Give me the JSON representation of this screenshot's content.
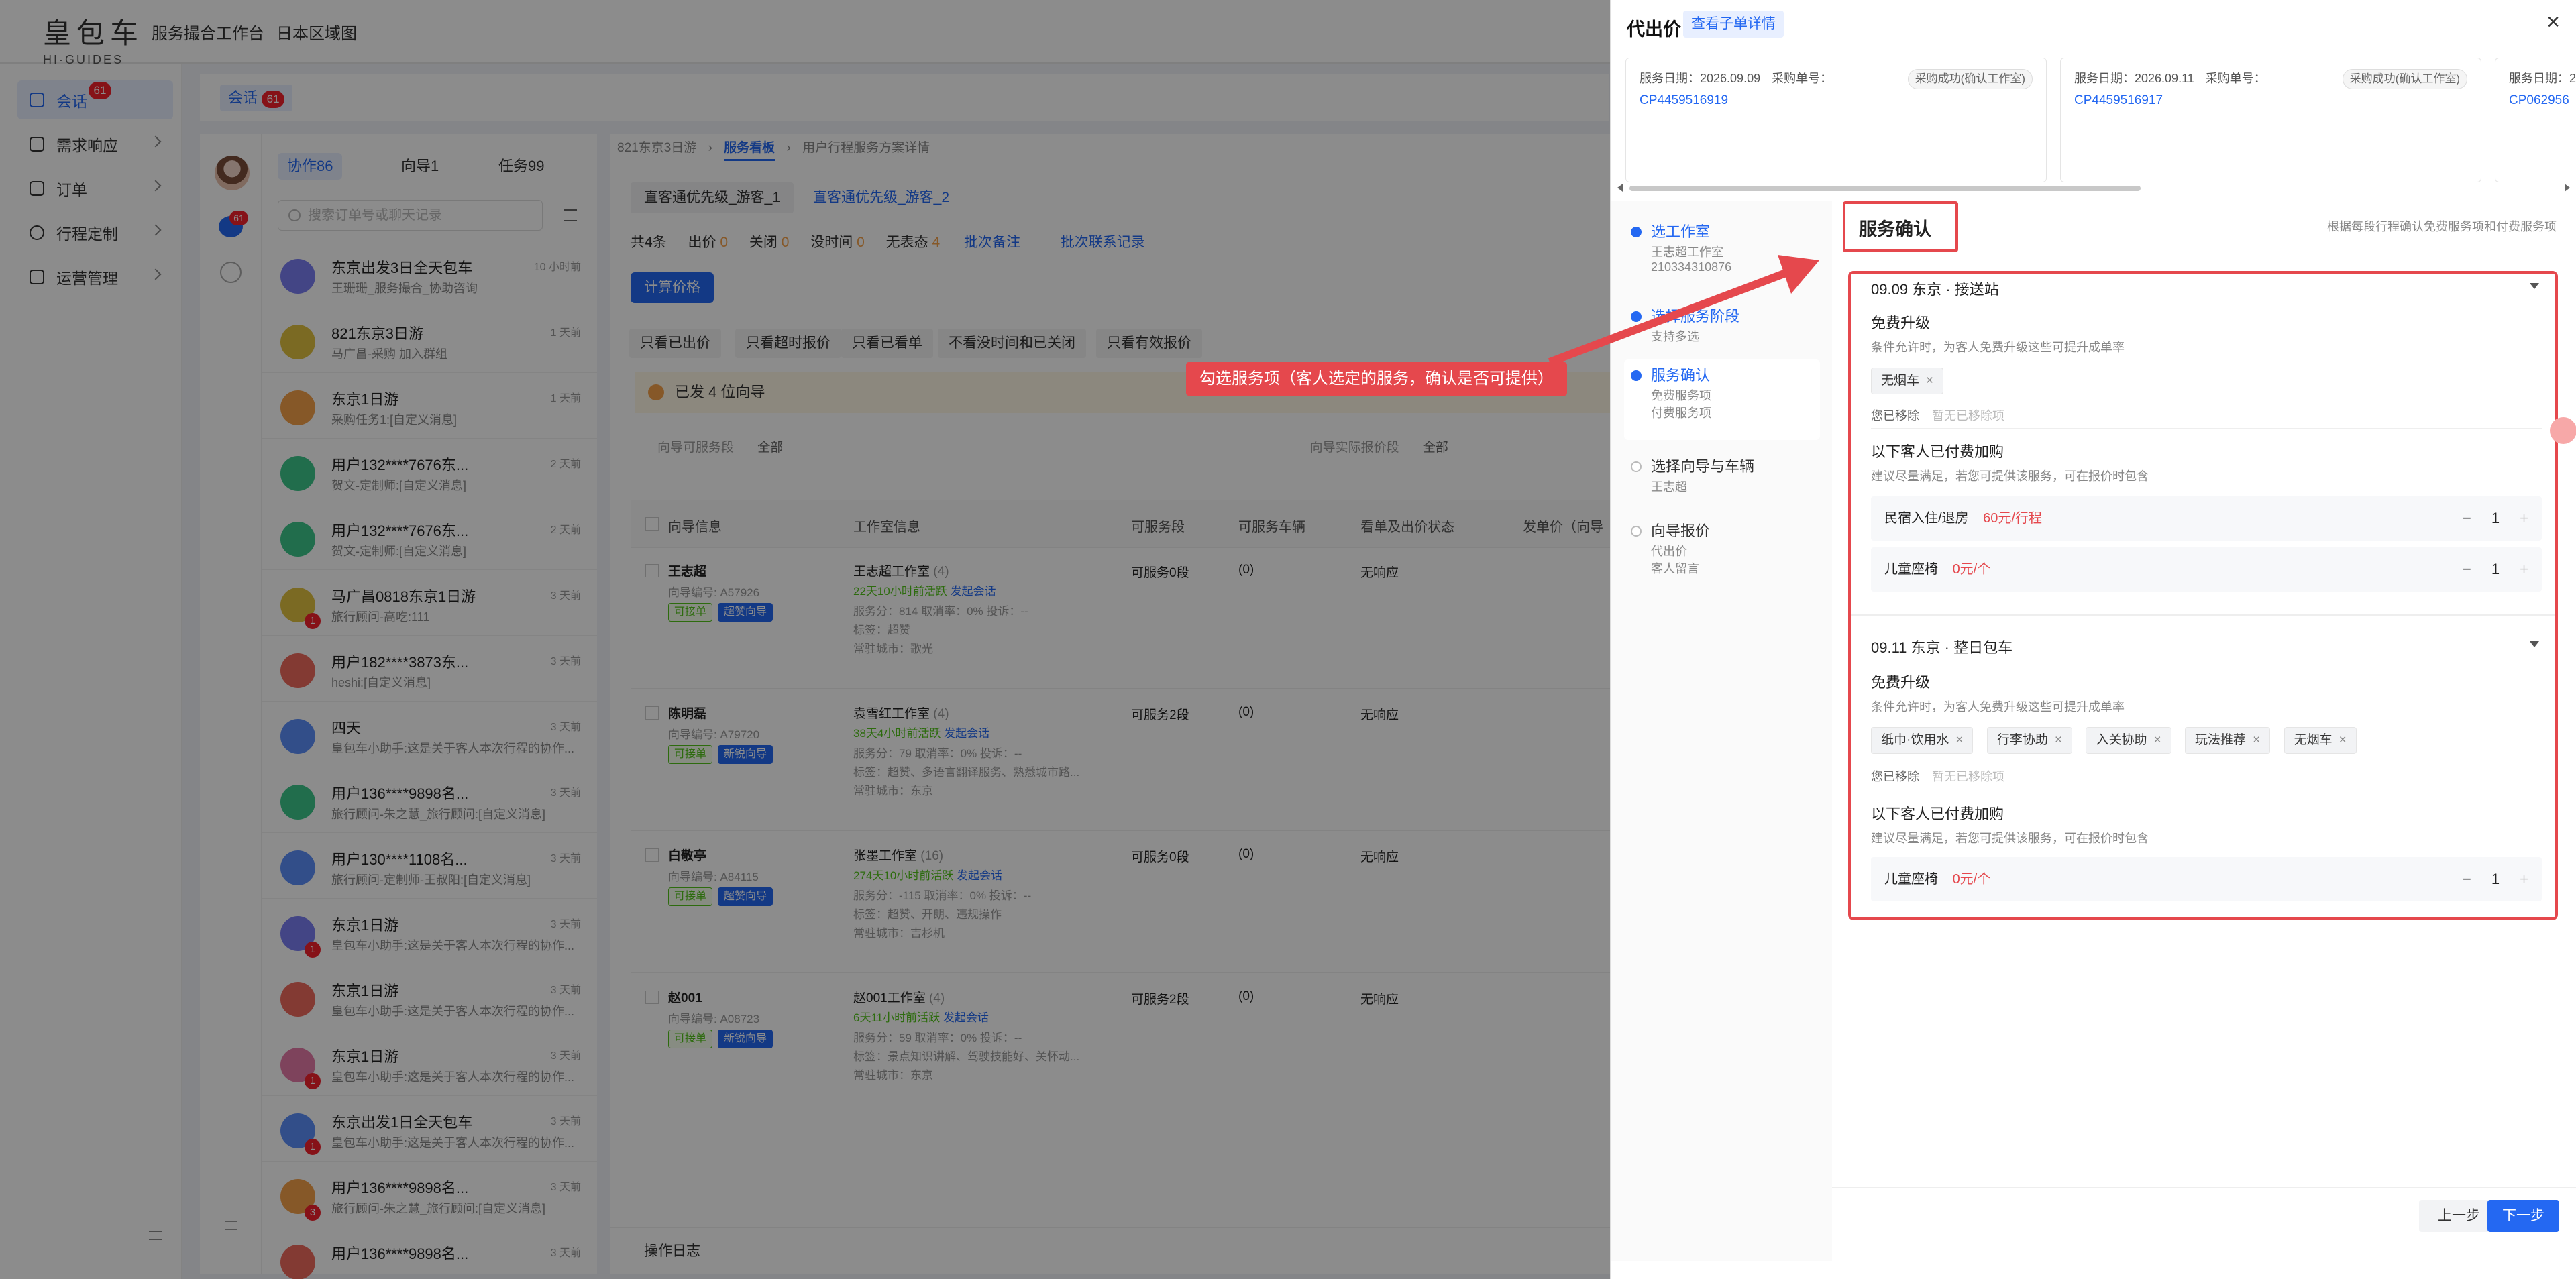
{
  "header": {
    "logo_cn": "皇包车",
    "logo_en": "HI·GUIDES",
    "nav": [
      "服务撮合工作台",
      "日本区域图"
    ]
  },
  "leftnav": {
    "items": [
      {
        "label": "会话",
        "badge": "61"
      },
      {
        "label": "需求响应"
      },
      {
        "label": "订单"
      },
      {
        "label": "行程定制"
      },
      {
        "label": "运营管理"
      }
    ]
  },
  "tabbar": {
    "tab": "会话",
    "badge": "61"
  },
  "iconcol": {
    "msg_badge": "61"
  },
  "convlist": {
    "tabs": [
      "协作86",
      "向导1",
      "任务99"
    ],
    "search_placeholder": "搜索订单号或聊天记录",
    "rows": [
      {
        "name": "东京出发3日全天包车",
        "msg": "王珊珊_服务撮合_协助咨询",
        "time": "10 小时前",
        "color": "#7b7ef2"
      },
      {
        "name": "821东京3日游",
        "msg": "马广昌-采购 加入群组",
        "time": "1 天前",
        "color": "#e0c141"
      },
      {
        "name": "东京1日游",
        "msg": "采购任务1:[自定义消息]",
        "time": "1 天前",
        "color": "#f5a04a"
      },
      {
        "name": "用户132****7676东...",
        "msg": "贺文-定制师:[自定义消息]",
        "time": "2 天前",
        "color": "#3cc68a"
      },
      {
        "name": "用户132****7676东...",
        "msg": "贺文-定制师:[自定义消息]",
        "time": "2 天前",
        "color": "#3cc68a"
      },
      {
        "name": "马广昌0818东京1日游",
        "msg": "旅行顾问-高吃:111",
        "time": "3 天前",
        "color": "#e0c141",
        "badge": "1"
      },
      {
        "name": "用户182****3873东...",
        "msg": "heshi:[自定义消息]",
        "time": "3 天前",
        "color": "#ef6b5e"
      },
      {
        "name": "四天",
        "msg": "皇包车小助手:这是关于客人本次行程的协作...",
        "time": "3 天前",
        "color": "#5b8ff9"
      },
      {
        "name": "用户136****9898名...",
        "msg": "旅行顾问-朱之慧_旅行顾问:[自定义消息]",
        "time": "3 天前",
        "color": "#3cc68a"
      },
      {
        "name": "用户130****1108名...",
        "msg": "旅行顾问-定制师-王叔阳:[自定义消息]",
        "time": "3 天前",
        "color": "#5b8ff9"
      },
      {
        "name": "东京1日游",
        "msg": "皇包车小助手:这是关于客人本次行程的协作...",
        "time": "3 天前",
        "color": "#7b7ef2",
        "badge": "1"
      },
      {
        "name": "东京1日游",
        "msg": "皇包车小助手:这是关于客人本次行程的协作...",
        "time": "3 天前",
        "color": "#ef6b5e"
      },
      {
        "name": "东京1日游",
        "msg": "皇包车小助手:这是关于客人本次行程的协作...",
        "time": "3 天前",
        "color": "#e57aa8",
        "badge": "1"
      },
      {
        "name": "东京出发1日全天包车",
        "msg": "皇包车小助手:这是关于客人本次行程的协作...",
        "time": "3 天前",
        "color": "#5b8ff9",
        "badge": "1"
      },
      {
        "name": "用户136****9898名...",
        "msg": "旅行顾问-朱之慧_旅行顾问:[自定义消息]",
        "time": "3 天前",
        "color": "#f5a04a",
        "badge": "3"
      },
      {
        "name": "用户136****9898名...",
        "msg": "",
        "time": "3 天前",
        "color": "#ef6b5e"
      }
    ]
  },
  "main": {
    "crumbs": [
      "821东京3日游",
      "服务看板",
      "用户行程服务方案详情"
    ],
    "pills": [
      "直客通优先级_游客_1",
      "直客通优先级_游客_2"
    ],
    "stats": {
      "total": "共4条",
      "items": [
        {
          "label": "出价",
          "value": "0"
        },
        {
          "label": "关闭",
          "value": "0"
        },
        {
          "label": "没时间",
          "value": "0"
        },
        {
          "label": "无表态",
          "value": "4"
        }
      ],
      "links": [
        "批次备注",
        "批次联系记录"
      ]
    },
    "calc_button": "计算价格",
    "filters": [
      "只看已出价",
      "只看超时报价",
      "只看已看单",
      "不看没时间和已关闭",
      "只看有效报价"
    ],
    "warning": "已发 4 位向导",
    "filter_row": {
      "label1": "向导可服务段",
      "val1": "全部",
      "label2": "向导实际报价段",
      "val2": "全部"
    },
    "columns": [
      "向导信息",
      "工作室信息",
      "可服务段",
      "可服务车辆",
      "看单及出价状态",
      "发单价（向导"
    ],
    "rows": [
      {
        "name": "王志超",
        "id": "向导编号: A57926",
        "tags": [
          "可接单",
          "超赞向导"
        ],
        "studio": "王志超工作室",
        "count": "(4)",
        "avail": "22天10小时前活跃",
        "link": "发起会话",
        "svc": "服务分：814  取消率：0%  投诉：--",
        "label": "标签：超赞",
        "city": "常驻城市：歌光",
        "seg": "可服务0段",
        "car": "(0)",
        "status": "无响应"
      },
      {
        "name": "陈明磊",
        "id": "向导编号: A79720",
        "tags": [
          "可接单",
          "新锐向导"
        ],
        "studio": "袁雪红工作室",
        "count": "(4)",
        "avail": "38天4小时前活跃",
        "link": "发起会话",
        "svc": "服务分：79  取消率：0%  投诉：--",
        "label": "标签：超赞、多语言翻译服务、熟悉城市路...",
        "city": "常驻城市：东京",
        "seg": "可服务2段",
        "car": "(0)",
        "status": "无响应"
      },
      {
        "name": "白敬亭",
        "id": "向导编号: A84115",
        "tags": [
          "可接单",
          "超赞向导"
        ],
        "studio": "张墨工作室",
        "count": "(16)",
        "avail": "274天10小时前活跃",
        "link": "发起会话",
        "svc": "服务分：-115  取消率：0%  投诉：--",
        "label": "标签：超赞、开朗、违规操作",
        "city": "常驻城市：吉杉机",
        "seg": "可服务0段",
        "car": "(0)",
        "status": "无响应"
      },
      {
        "name": "赵001",
        "id": "向导编号: A08723",
        "tags": [
          "可接单",
          "新锐向导"
        ],
        "studio": "赵001工作室",
        "count": "(4)",
        "avail": "6天11小时前活跃",
        "link": "发起会话",
        "svc": "服务分：59  取消率：0%  投诉：--",
        "label": "标签：景点知识讲解、驾驶技能好、关怀动...",
        "city": "常驻城市：东京",
        "seg": "可服务2段",
        "car": "(0)",
        "status": "无响应"
      }
    ],
    "log": "操作日志"
  },
  "drawer": {
    "title": "代出价",
    "title_link": "查看子单详情",
    "close": "×",
    "cards": [
      {
        "date": "服务日期：2026.09.09",
        "label": "采购单号：",
        "code": "CP4459516919",
        "status": "采购成功(确认工作室)"
      },
      {
        "date": "服务日期：2026.09.11",
        "label": "采购单号：",
        "code": "CP4459516917",
        "status": "采购成功(确认工作室)"
      },
      {
        "date": "服务日期：2",
        "label": "",
        "code": "CP062956",
        "status": ""
      }
    ],
    "steps": [
      {
        "title": "选工作室",
        "subs": [
          "王志超工作室",
          "210334310876"
        ],
        "state": "done"
      },
      {
        "title": "选择服务阶段",
        "subs": [
          "支持多选"
        ],
        "state": "done"
      },
      {
        "title": "服务确认",
        "subs": [
          "免费服务项",
          "付费服务项"
        ],
        "state": "active"
      },
      {
        "title": "选择向导与车辆",
        "subs": [
          "王志超"
        ],
        "state": "todo"
      },
      {
        "title": "向导报价",
        "subs": [
          "代出价",
          "客人留言"
        ],
        "state": "todo"
      }
    ],
    "section_title": "服务确认",
    "section_note": "根据每段行程确认免费服务项和付费服务项",
    "segments": [
      {
        "title": "09.09 东京 · 接送站",
        "free_title": "免费升级",
        "free_sub": "条件允许时，为客人免费升级这些可提升成单率",
        "chips": [
          "无烟车"
        ],
        "removed_label": "您已移除",
        "removed_empty": "暂无已移除项",
        "paid_title": "以下客人已付费加购",
        "paid_sub": "建议尽量满足，若您可提供该服务，可在报价时包含",
        "paid": [
          {
            "name": "民宿入住/退房",
            "price": "60元/行程",
            "qty": "1"
          },
          {
            "name": "儿童座椅",
            "price": "0元/个",
            "qty": "1"
          }
        ]
      },
      {
        "title": "09.11 东京 · 整日包车",
        "free_title": "免费升级",
        "free_sub": "条件允许时，为客人免费升级这些可提升成单率",
        "chips": [
          "纸巾·饮用水",
          "行李协助",
          "入关协助",
          "玩法推荐",
          "无烟车"
        ],
        "removed_label": "您已移除",
        "removed_empty": "暂无已移除项",
        "paid_title": "以下客人已付费加购",
        "paid_sub": "建议尽量满足，若您可提供该服务，可在报价时包含",
        "paid": [
          {
            "name": "儿童座椅",
            "price": "0元/个",
            "qty": "1"
          }
        ]
      }
    ],
    "prev": "上一步",
    "next": "下一步"
  },
  "annotation": {
    "text": "勾选服务项（客人选定的服务，确认是否可提供）"
  },
  "colors": {
    "accent": "#2468f2",
    "annotation": "#e5484d",
    "badge": "#f5222d"
  }
}
